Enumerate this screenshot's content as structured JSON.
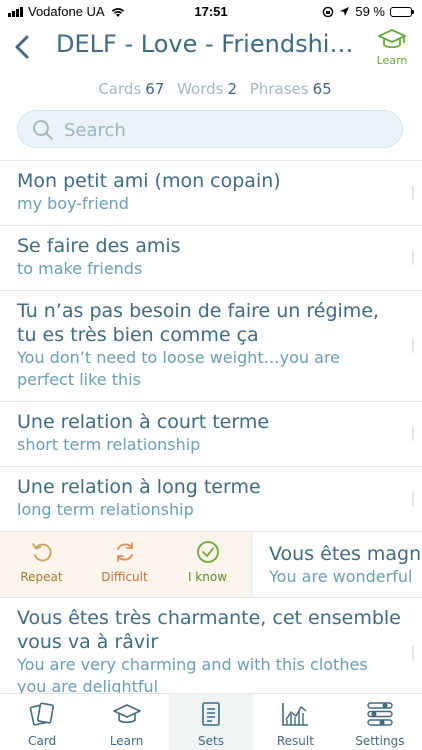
{
  "status": {
    "carrier": "Vodafone UA",
    "time": "17:51",
    "battery": "59 %",
    "battery_level": 0.59
  },
  "nav": {
    "title": "DELF - Love - Friendship…",
    "learn_label": "Learn",
    "learn_color": "#6aaa3a"
  },
  "counts": [
    {
      "label": "Cards",
      "value": "67"
    },
    {
      "label": "Words",
      "value": "2"
    },
    {
      "label": "Phrases",
      "value": "65"
    }
  ],
  "search": {
    "placeholder": "Search",
    "value": ""
  },
  "items": [
    {
      "fr": "Mon petit ami (mon copain)",
      "en": "my boy-friend"
    },
    {
      "fr": "Se faire des amis",
      "en": "to make friends"
    },
    {
      "fr": "Tu n’as pas besoin de faire un régime, tu es très bien comme ça",
      "en": "You don’t need to loose weight…you are perfect like this"
    },
    {
      "fr": "Une relation à court terme",
      "en": "short term relationship"
    },
    {
      "fr": "Une relation à long terme",
      "en": "long term relationship"
    }
  ],
  "swiped_item": {
    "fr": "Vous êtes magnifique",
    "en": "You are wonderful",
    "actions": [
      {
        "label": "Repeat",
        "icon": "repeat-icon",
        "color": "#a07a2c"
      },
      {
        "label": "Difficult",
        "icon": "difficult-icon",
        "color": "#c86a3a"
      },
      {
        "label": "I know",
        "icon": "check-circle-icon",
        "color": "#5a8a26"
      }
    ]
  },
  "last_item": {
    "fr": "Vous êtes très charmante, cet ensemble vous va à râvir",
    "en": "You are very charming and with this clothes you are delightful"
  },
  "tabs": [
    {
      "label": "Card",
      "icon": "cards-icon"
    },
    {
      "label": "Learn",
      "icon": "graduation-cap-icon"
    },
    {
      "label": "Sets",
      "icon": "document-icon",
      "active": true
    },
    {
      "label": "Result",
      "icon": "chart-icon"
    },
    {
      "label": "Settings",
      "icon": "sliders-icon"
    }
  ],
  "colors": {
    "primary": "#3f6b80",
    "secondary": "#6a9eb3",
    "muted": "#a3b9c4",
    "accent_green": "#6aaa3a"
  }
}
